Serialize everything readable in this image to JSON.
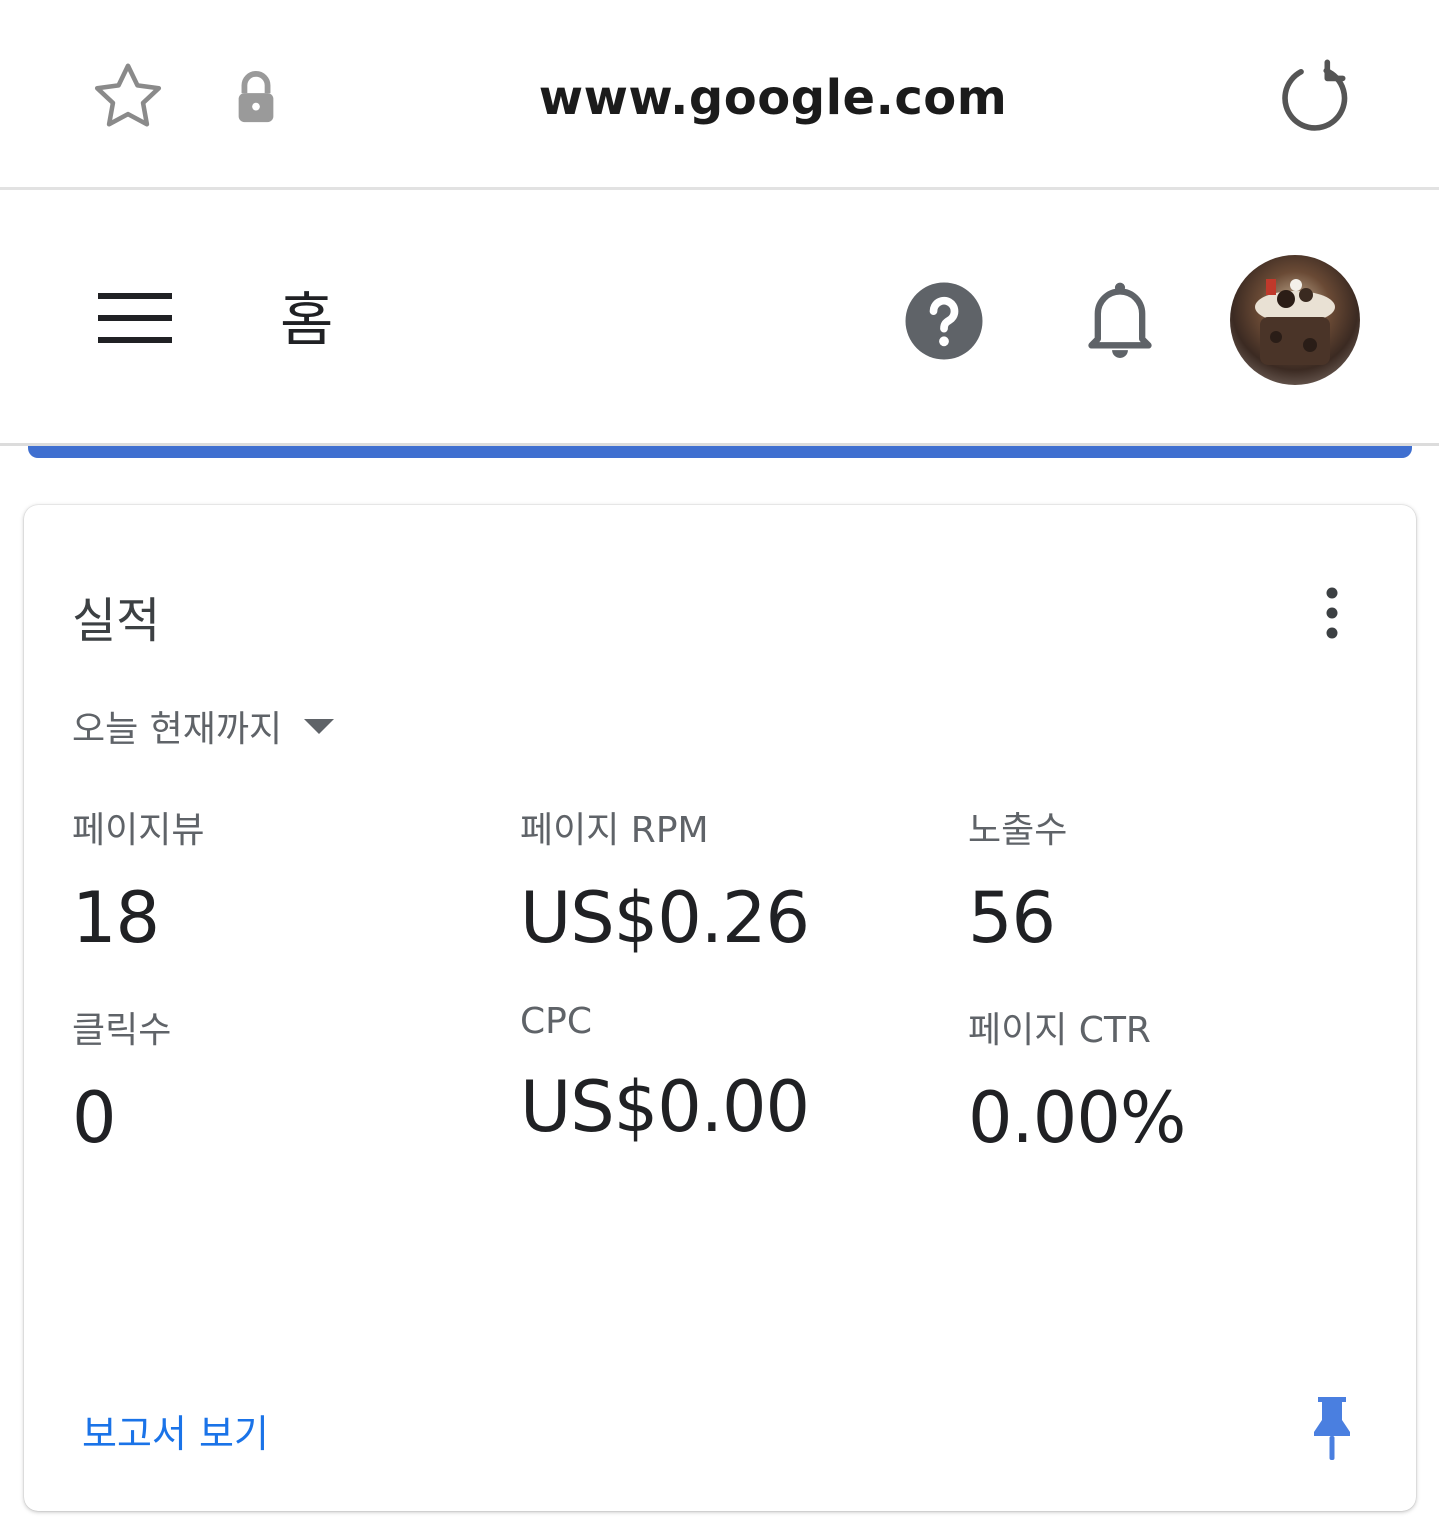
{
  "browser": {
    "url": "www.google.com"
  },
  "header": {
    "title": "홈",
    "icons": [
      "menu-icon",
      "help-icon",
      "bell-icon",
      "avatar"
    ]
  },
  "card": {
    "title": "실적",
    "date_range": "오늘 현재까지",
    "metrics": [
      {
        "label": "페이지뷰",
        "value": "18"
      },
      {
        "label": "페이지 RPM",
        "value": "US$0.26"
      },
      {
        "label": "노출수",
        "value": "56"
      },
      {
        "label": "클릭수",
        "value": "0"
      },
      {
        "label": "CPC",
        "value": "US$0.00"
      },
      {
        "label": "페이지 CTR",
        "value": "0.00%"
      }
    ],
    "report_link": "보고서 보기"
  },
  "colors": {
    "accent_blue": "#1a73e8",
    "strip_blue": "#3f6fd0",
    "icon_gray": "#5f6368"
  }
}
